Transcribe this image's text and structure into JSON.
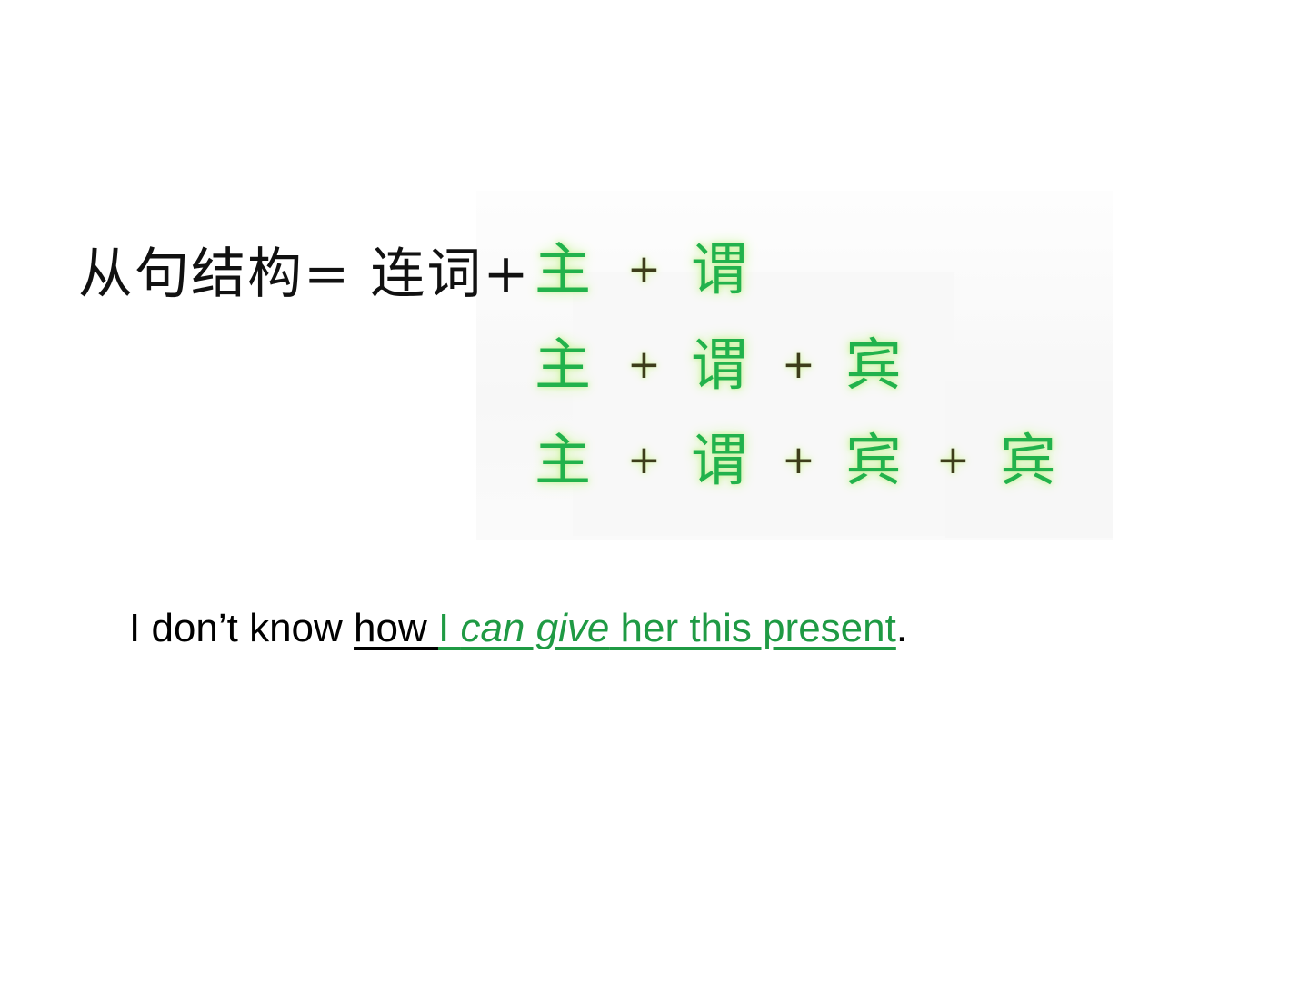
{
  "formula": {
    "label": "从句结构=  连词+"
  },
  "structures": [
    {
      "tokens": [
        "主",
        "+",
        "谓"
      ]
    },
    {
      "tokens": [
        "主",
        "+",
        "谓",
        "+",
        "宾"
      ]
    },
    {
      "tokens": [
        "主",
        "+",
        "谓",
        "+",
        "宾",
        "+",
        "宾"
      ]
    }
  ],
  "example": {
    "before": "I don’t know ",
    "conjunction": "how ",
    "subject": "I ",
    "predicate": "can give",
    "rest": " her this present",
    "end": "."
  },
  "colors": {
    "highlight_green": "#22b24c",
    "sentence_green": "#1f9a44",
    "glow": "#c9f29b"
  }
}
